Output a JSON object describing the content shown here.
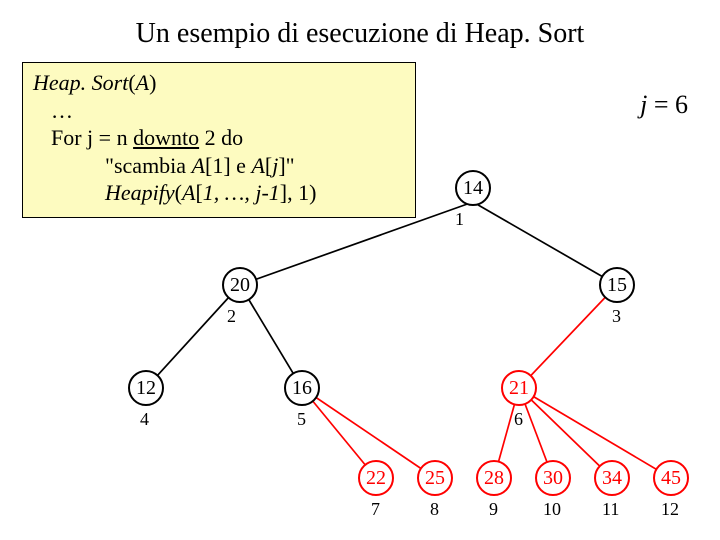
{
  "title": "Un esempio di esecuzione di Heap. Sort",
  "code": {
    "l1a": "Heap. Sort",
    "l1b": "(",
    "l1c": "A",
    "l1d": ")",
    "l2": "…",
    "l3a": "For j  = n ",
    "l3b": "downto",
    "l3c": " 2 do",
    "l4a": "\"scambia ",
    "l4b": "A",
    "l4c": "[1] e ",
    "l4d": "A",
    "l4e": "[",
    "l4f": "j",
    "l4g": "]\"",
    "l5a": "Heapify",
    "l5b": "(",
    "l5c": "A",
    "l5d": "[",
    "l5e": "1, …, j-1",
    "l5f": "], 1)"
  },
  "j_label": {
    "var": "j",
    "eq": " = ",
    "val": "6"
  },
  "nodes": {
    "n1": "14",
    "n2": "20",
    "n3": "15",
    "n4": "12",
    "n5": "16",
    "n6": "21",
    "n7": "22",
    "n8": "25",
    "n9": "28",
    "n10": "30",
    "n11": "34",
    "n12": "45"
  },
  "indices": {
    "i1": "1",
    "i2": "2",
    "i3": "3",
    "i4": "4",
    "i5": "5",
    "i6": "6",
    "i7": "7",
    "i8": "8",
    "i9": "9",
    "i10": "10",
    "i11": "11",
    "i12": "12"
  },
  "chart_data": {
    "type": "tree",
    "title": "Heap state during HeapSort, j=6",
    "nodes": [
      {
        "id": 1,
        "value": 14,
        "sorted": false
      },
      {
        "id": 2,
        "value": 20,
        "sorted": false
      },
      {
        "id": 3,
        "value": 15,
        "sorted": false
      },
      {
        "id": 4,
        "value": 12,
        "sorted": false
      },
      {
        "id": 5,
        "value": 16,
        "sorted": false
      },
      {
        "id": 6,
        "value": 21,
        "sorted": true
      },
      {
        "id": 7,
        "value": 22,
        "sorted": true
      },
      {
        "id": 8,
        "value": 25,
        "sorted": true
      },
      {
        "id": 9,
        "value": 28,
        "sorted": true
      },
      {
        "id": 10,
        "value": 30,
        "sorted": true
      },
      {
        "id": 11,
        "value": 34,
        "sorted": true
      },
      {
        "id": 12,
        "value": 45,
        "sorted": true
      }
    ],
    "edges": [
      [
        1,
        2
      ],
      [
        1,
        3
      ],
      [
        2,
        4
      ],
      [
        2,
        5
      ],
      [
        3,
        6
      ],
      [
        5,
        7
      ],
      [
        5,
        8
      ],
      [
        6,
        9
      ],
      [
        6,
        10
      ],
      [
        6,
        11
      ],
      [
        6,
        12
      ]
    ]
  }
}
